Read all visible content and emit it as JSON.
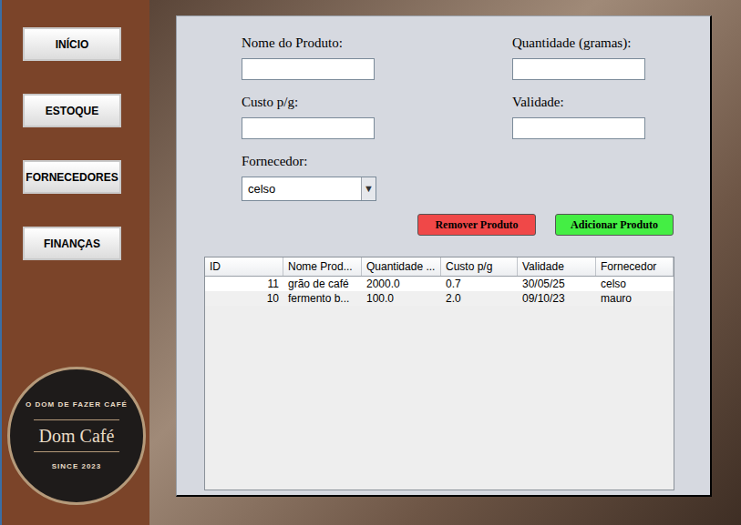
{
  "sidebar": {
    "items": [
      {
        "label": "INÍCIO",
        "selected": false
      },
      {
        "label": "ESTOQUE",
        "selected": false
      },
      {
        "label": "FORNECEDORES",
        "selected": false
      },
      {
        "label": "FINANÇAS",
        "selected": false
      }
    ],
    "logo": {
      "tagline": "O DOM DE FAZER CAFÉ",
      "name": "Dom Café",
      "since": "SINCE 2023"
    }
  },
  "form": {
    "fields": [
      {
        "label": "Nome do Produto:",
        "value": ""
      },
      {
        "label": "Quantidade (gramas):",
        "value": ""
      },
      {
        "label": "Custo p/g:",
        "value": ""
      },
      {
        "label": "Validade:",
        "value": ""
      }
    ],
    "supplier": {
      "label": "Fornecedor:",
      "value": "celso",
      "arrow": "▼"
    }
  },
  "buttons": [
    {
      "label": "Remover Produto",
      "color": "#f04848"
    },
    {
      "label": "Adicionar Produto",
      "color": "#44ee44"
    }
  ],
  "table": {
    "columns": [
      "ID",
      "Nome Prod...",
      "Quantidade ...",
      "Custo p/g",
      "Validade",
      "Fornecedor"
    ],
    "rows": [
      {
        "cells": [
          "11",
          "grão de café",
          "2000.0",
          "0.7",
          "30/05/25",
          "celso"
        ],
        "selected": false
      },
      {
        "cells": [
          "10",
          "fermento b...",
          "100.0",
          "2.0",
          "09/10/23",
          "mauro"
        ],
        "selected": false
      }
    ]
  }
}
